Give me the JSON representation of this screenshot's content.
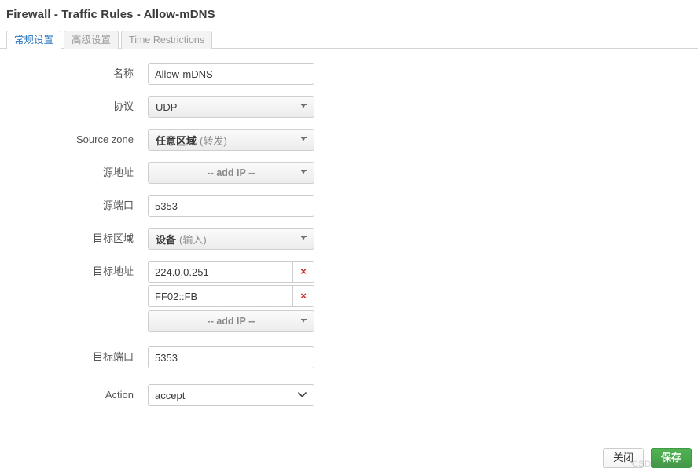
{
  "header": {
    "title": "Firewall - Traffic Rules - Allow-mDNS"
  },
  "tabs": [
    {
      "label": "常规设置",
      "active": true
    },
    {
      "label": "高级设置",
      "active": false
    },
    {
      "label": "Time Restrictions",
      "active": false
    }
  ],
  "form": {
    "name": {
      "label": "名称",
      "value": "Allow-mDNS",
      "type": "text"
    },
    "protocol": {
      "label": "协议",
      "value": "UDP",
      "type": "select"
    },
    "source_zone": {
      "label": "Source zone",
      "value_strong": "任意区域",
      "value_dim": "(转发)",
      "type": "select"
    },
    "source_address": {
      "label": "源地址",
      "placeholder": "-- add IP --",
      "type": "select"
    },
    "source_port": {
      "label": "源端口",
      "value": "5353",
      "type": "text"
    },
    "dest_zone": {
      "label": "目标区域",
      "value_strong": "设备",
      "value_dim": "(输入)",
      "type": "select"
    },
    "dest_address": {
      "label": "目标地址",
      "entries": [
        {
          "value": "224.0.0.251",
          "remove_label": "×"
        },
        {
          "value": "FF02::FB",
          "remove_label": "×"
        }
      ],
      "placeholder": "-- add IP --"
    },
    "dest_port": {
      "label": "目标端口",
      "value": "5353",
      "type": "text"
    },
    "action": {
      "label": "Action",
      "value": "accept",
      "type": "select"
    }
  },
  "footer": {
    "close_label": "关闭",
    "save_label": "保存"
  },
  "watermark": {
    "text": "CSDN @wn9"
  },
  "colors": {
    "accent": "#2d77c2",
    "save_green": "#3d9a41",
    "remove_red": "#cc2a2a"
  }
}
